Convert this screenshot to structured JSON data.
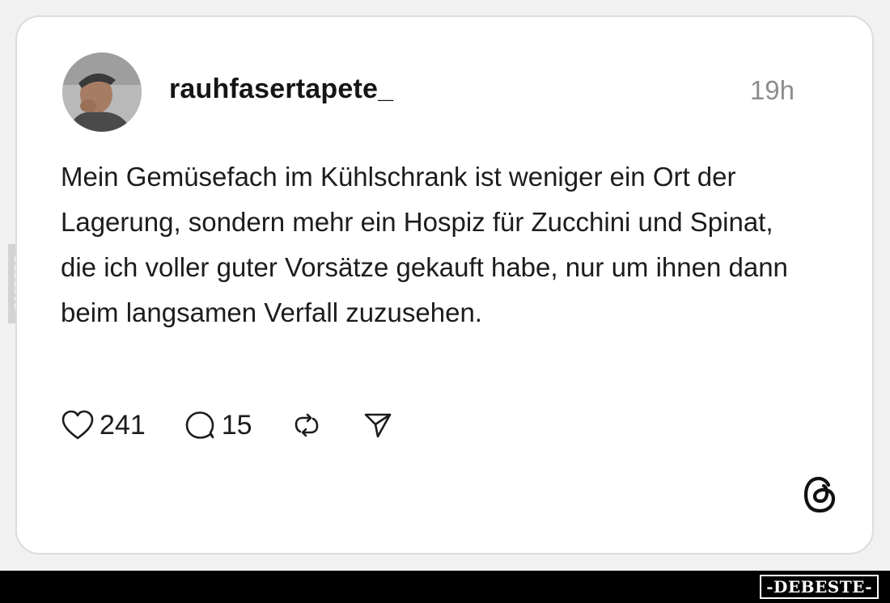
{
  "post": {
    "username": "rauhfasertapete_",
    "timestamp": "19h",
    "text": "Mein Gemüsefach im Kühlschrank ist weniger ein Ort der Lagerung, sondern mehr ein Hospiz für Zucchini und Spinat, die ich voller guter Vorsätze gekauft habe, nur um ihnen dann beim langsamen Verfall zuzusehen.",
    "likes": "241",
    "comments": "15"
  },
  "icons": {
    "like": "heart-icon",
    "comment": "comment-bubble-icon",
    "repost": "repost-icon",
    "share": "send-icon",
    "logo": "threads-logo-icon"
  },
  "watermark": {
    "side": "DEBESTE",
    "brand": "-DEBESTE-"
  },
  "colors": {
    "text": "#1c1c1c",
    "muted": "#8d8d8d",
    "card": "#ffffff",
    "background": "#f1f1f1"
  }
}
